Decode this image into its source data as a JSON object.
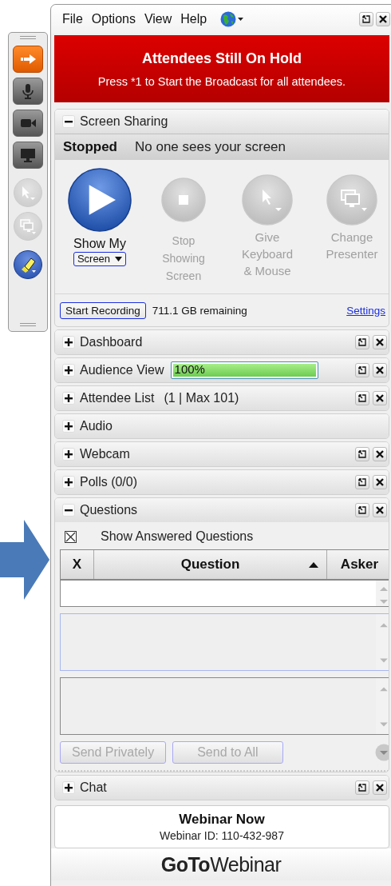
{
  "toolbar": [
    {
      "kind": "arrow",
      "disabled": false
    },
    {
      "kind": "mic",
      "disabled": false
    },
    {
      "kind": "webcam",
      "disabled": false
    },
    {
      "kind": "screen",
      "disabled": false
    },
    {
      "kind": "pointer",
      "disabled": true
    },
    {
      "kind": "screens",
      "disabled": true
    },
    {
      "kind": "draw",
      "disabled": false
    }
  ],
  "menu": [
    "File",
    "Options",
    "View",
    "Help"
  ],
  "banner": {
    "title": "Attendees Still On Hold",
    "message": "Press *1 to Start the Broadcast for all attendees."
  },
  "sections": [
    {
      "title": "Screen Sharing",
      "expanded": true,
      "controls": false,
      "kind": "screen_sharing",
      "status": "Stopped",
      "status_text": "No one sees your screen",
      "actions": [
        {
          "kind": "play",
          "lines": [
            "Show My"
          ],
          "dropdown": "Screen",
          "disabled": false
        },
        {
          "kind": "stop",
          "lines": [
            "Stop",
            "Showing",
            "Screen"
          ],
          "disabled": true
        },
        {
          "kind": "pointer",
          "lines": [
            "Give",
            "Keyboard",
            "& Mouse"
          ],
          "disabled": true
        },
        {
          "kind": "screens",
          "lines": [
            "Change",
            "Presenter"
          ],
          "disabled": true
        }
      ],
      "record_button": "Start Recording",
      "remaining": "711.1 GB remaining",
      "settings_link": "Settings"
    },
    {
      "title": "Dashboard",
      "expanded": false,
      "controls": true
    },
    {
      "title": "Audience View",
      "expanded": false,
      "controls": true,
      "level": 1.0,
      "reading": "100%"
    },
    {
      "title": "Attendee List",
      "count": "(1 | Max 101)",
      "expanded": false,
      "controls": true
    },
    {
      "title": "Audio",
      "expanded": false,
      "controls": false
    },
    {
      "title": "Webcam",
      "expanded": false,
      "controls": true
    },
    {
      "title": "Polls (0/0)",
      "expanded": false,
      "controls": true
    },
    {
      "title": "Questions",
      "expanded": true,
      "controls": true,
      "kind": "questions",
      "show_answered": {
        "label": "Show Answered Questions",
        "checked": true
      },
      "columns": [
        {
          "label": "X",
          "sorted": false
        },
        {
          "label": "Question",
          "sorted": true
        },
        {
          "label": "Asker",
          "sorted": false
        }
      ],
      "buttons": [
        {
          "label": "Send Privately",
          "disabled": true
        },
        {
          "label": "Send to All",
          "disabled": true
        }
      ]
    },
    {
      "title": "Chat",
      "expanded": false,
      "controls": true
    }
  ],
  "footer": {
    "title": "Webinar Now",
    "webinar_id": "Webinar ID: 110-432-987",
    "logo": "**GoTo**Webinar"
  }
}
